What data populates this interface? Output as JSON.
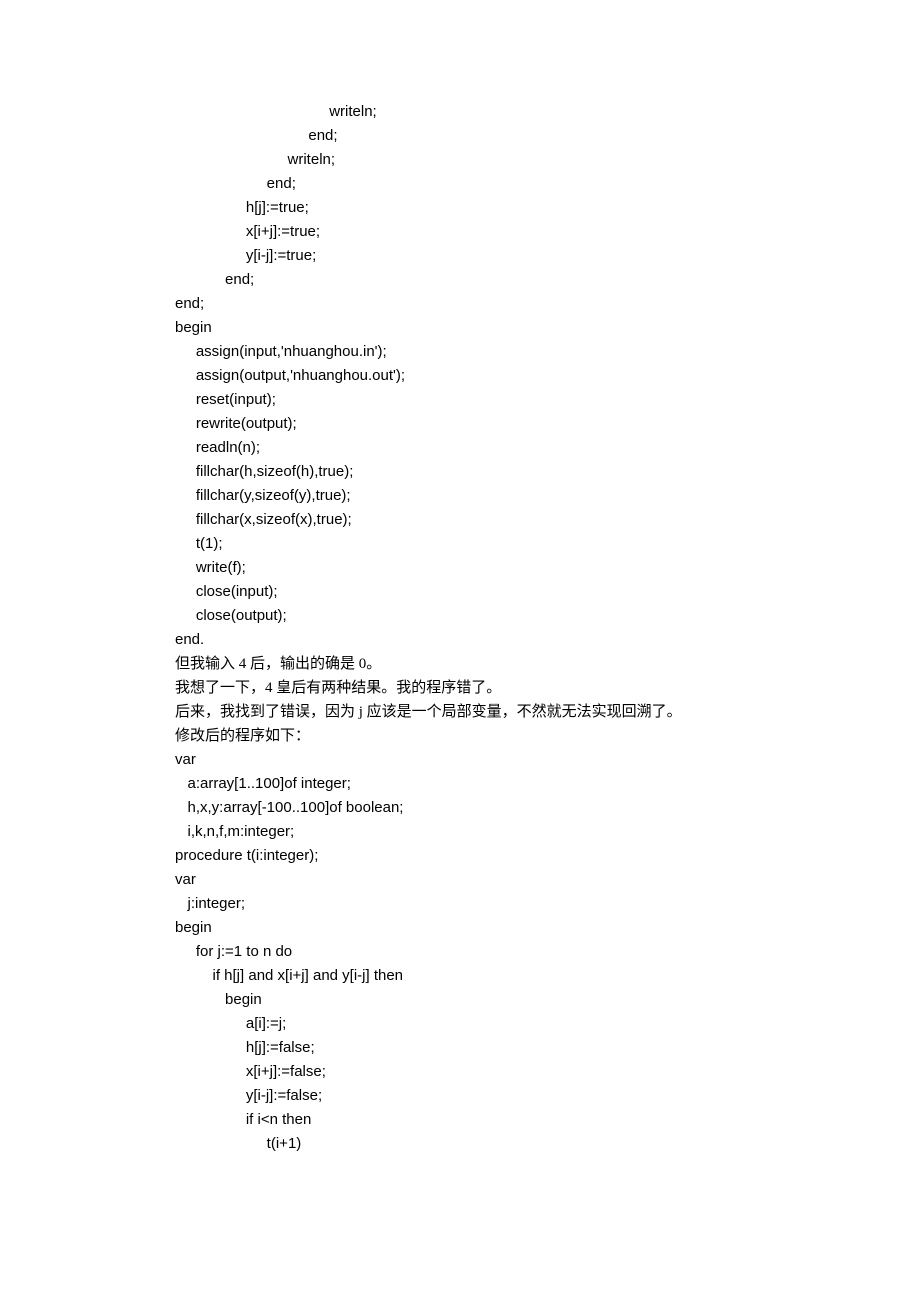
{
  "lines": [
    {
      "cls": "code",
      "text": "                                     writeln;"
    },
    {
      "cls": "code",
      "text": "                                end;"
    },
    {
      "cls": "code",
      "text": "                           writeln;"
    },
    {
      "cls": "code",
      "text": "                      end;"
    },
    {
      "cls": "code",
      "text": "                 h[j]:=true;"
    },
    {
      "cls": "code",
      "text": "                 x[i+j]:=true;"
    },
    {
      "cls": "code",
      "text": "                 y[i-j]:=true;"
    },
    {
      "cls": "code",
      "text": "            end;"
    },
    {
      "cls": "code",
      "text": "end;"
    },
    {
      "cls": "code",
      "text": "begin"
    },
    {
      "cls": "code",
      "text": "     assign(input,'nhuanghou.in');"
    },
    {
      "cls": "code",
      "text": "     assign(output,'nhuanghou.out');"
    },
    {
      "cls": "code",
      "text": "     reset(input);"
    },
    {
      "cls": "code",
      "text": "     rewrite(output);"
    },
    {
      "cls": "code",
      "text": "     readln(n);"
    },
    {
      "cls": "code",
      "text": "     fillchar(h,sizeof(h),true);"
    },
    {
      "cls": "code",
      "text": "     fillchar(y,sizeof(y),true);"
    },
    {
      "cls": "code",
      "text": "     fillchar(x,sizeof(x),true);"
    },
    {
      "cls": "code",
      "text": "     t(1);"
    },
    {
      "cls": "code",
      "text": "     write(f);"
    },
    {
      "cls": "code",
      "text": "     close(input);"
    },
    {
      "cls": "code",
      "text": "     close(output);"
    },
    {
      "cls": "code",
      "text": "end."
    },
    {
      "cls": "prose",
      "text": "但我输入 4 后，输出的确是 0。"
    },
    {
      "cls": "prose",
      "text": "我想了一下，4 皇后有两种结果。我的程序错了。"
    },
    {
      "cls": "prose",
      "text": "后来，我找到了错误，因为 j 应该是一个局部变量，不然就无法实现回溯了。"
    },
    {
      "cls": "prose",
      "text": "修改后的程序如下："
    },
    {
      "cls": "code",
      "text": "var"
    },
    {
      "cls": "code",
      "text": "   a:array[1..100]of integer;"
    },
    {
      "cls": "code",
      "text": "   h,x,y:array[-100..100]of boolean;"
    },
    {
      "cls": "code",
      "text": "   i,k,n,f,m:integer;"
    },
    {
      "cls": "code",
      "text": "procedure t(i:integer);"
    },
    {
      "cls": "code",
      "text": "var"
    },
    {
      "cls": "code",
      "text": "   j:integer;"
    },
    {
      "cls": "code",
      "text": "begin"
    },
    {
      "cls": "code",
      "text": "     for j:=1 to n do"
    },
    {
      "cls": "code",
      "text": "         if h[j] and x[i+j] and y[i-j] then"
    },
    {
      "cls": "code",
      "text": "            begin"
    },
    {
      "cls": "code",
      "text": "                 a[i]:=j;"
    },
    {
      "cls": "code",
      "text": "                 h[j]:=false;"
    },
    {
      "cls": "code",
      "text": "                 x[i+j]:=false;"
    },
    {
      "cls": "code",
      "text": "                 y[i-j]:=false;"
    },
    {
      "cls": "code",
      "text": "                 if i<n then"
    },
    {
      "cls": "code",
      "text": "                      t(i+1)"
    }
  ]
}
